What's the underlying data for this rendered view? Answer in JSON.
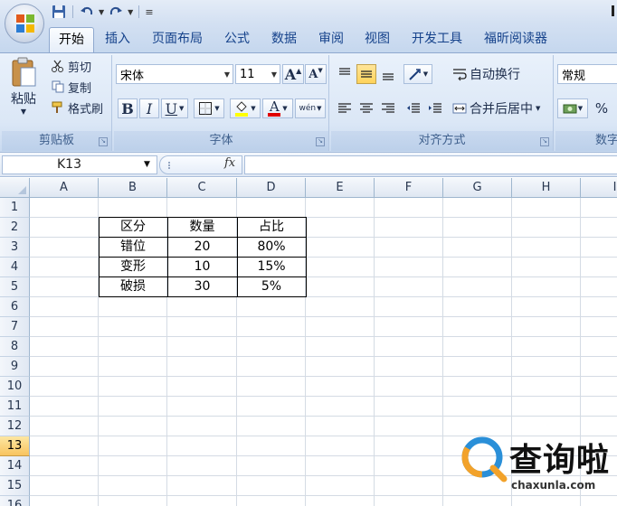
{
  "quick_access": {
    "save_icon": "save-icon",
    "undo_icon": "undo-icon",
    "redo_icon": "redo-icon"
  },
  "tabs": [
    {
      "label": "开始",
      "active": true
    },
    {
      "label": "插入"
    },
    {
      "label": "页面布局"
    },
    {
      "label": "公式"
    },
    {
      "label": "数据"
    },
    {
      "label": "审阅"
    },
    {
      "label": "视图"
    },
    {
      "label": "开发工具"
    },
    {
      "label": "福昕阅读器"
    }
  ],
  "clipboard": {
    "paste": "粘贴",
    "cut": "剪切",
    "copy": "复制",
    "format_painter": "格式刷",
    "group_label": "剪贴板"
  },
  "font": {
    "name": "宋体",
    "size": "11",
    "group_label": "字体",
    "bold": "B",
    "italic": "I",
    "underline": "U",
    "font_color_letter": "A",
    "font_color": "#e00000",
    "fill_color": "#ffff00",
    "grow_letter": "A",
    "shrink_letter": "A",
    "phonetic": "wén"
  },
  "alignment": {
    "wrap_text": "自动换行",
    "merge_center": "合并后居中",
    "group_label": "对齐方式"
  },
  "number": {
    "format": "常规",
    "percent": "%",
    "group_label_partial": "数字"
  },
  "formula_bar": {
    "name_box": "K13",
    "fx": "fx",
    "value": ""
  },
  "sheet": {
    "columns": [
      "A",
      "B",
      "C",
      "D",
      "E",
      "F",
      "G",
      "H",
      "I"
    ],
    "rows": [
      "1",
      "2",
      "3",
      "4",
      "5",
      "6",
      "7",
      "8",
      "9",
      "10",
      "11",
      "12",
      "13",
      "14",
      "15",
      "16"
    ],
    "active_row": "13",
    "table": {
      "headers": [
        "区分",
        "数量",
        "占比"
      ],
      "rows": [
        [
          "错位",
          "20",
          "80%"
        ],
        [
          "变形",
          "10",
          "15%"
        ],
        [
          "破损",
          "30",
          "5%"
        ]
      ]
    }
  },
  "watermark": {
    "brand": "查询啦",
    "domain": "chaxunla.com"
  }
}
